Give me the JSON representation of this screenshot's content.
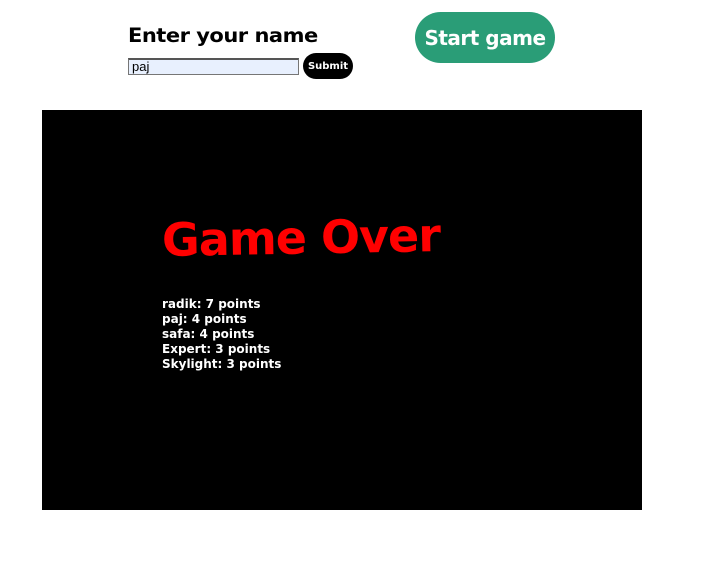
{
  "name_form": {
    "label": "Enter your name",
    "input_value": "paj",
    "submit_label": "Submit"
  },
  "start_button": {
    "label": "Start game",
    "color": "#2a9d77"
  },
  "game": {
    "background": "#000000",
    "title": "Game Over",
    "title_color": "#ff0000",
    "scores": [
      "radik: 7 points",
      "paj: 4 points",
      "safa: 4 points",
      "Expert: 3 points",
      "Skylight: 3 points"
    ]
  }
}
